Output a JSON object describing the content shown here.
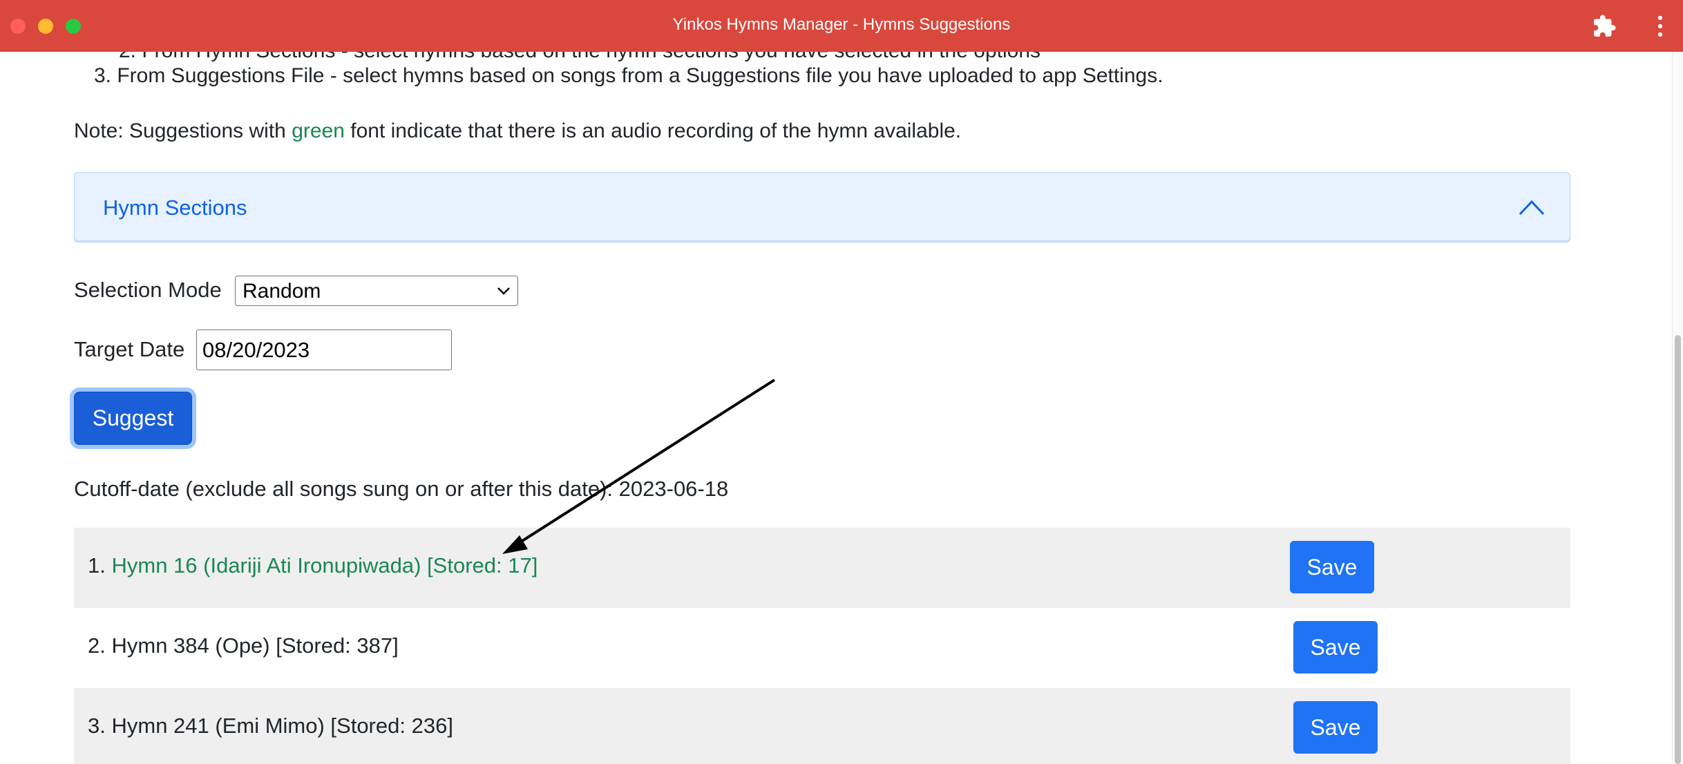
{
  "window": {
    "title": "Yinkos Hymns Manager - Hymns Suggestions"
  },
  "instructions": {
    "partial_line": "2. From Hymn Sections - select hymns based on the hymn sections you have selected in the options",
    "item3": "3. From Suggestions File - select hymns based on songs from a Suggestions file you have uploaded to app Settings."
  },
  "note": {
    "prefix": "Note: Suggestions with ",
    "highlight": "green",
    "suffix": " font indicate that there is an audio recording of the hymn available.",
    "highlight_color": "#198754"
  },
  "accordion": {
    "title": "Hymn Sections",
    "expanded": true
  },
  "selection_mode": {
    "label": "Selection Mode",
    "value": "Random"
  },
  "target_date": {
    "label": "Target Date",
    "value": "08/20/2023"
  },
  "suggest_button": {
    "label": "Suggest"
  },
  "cutoff": {
    "text": "Cutoff-date (exclude all songs sung on or after this date): 2023-06-18"
  },
  "results": [
    {
      "number": "1.",
      "text": "Hymn 16 (Idariji Ati Ironupiwada) [Stored: 17]",
      "has_audio": true,
      "save_label": "Save"
    },
    {
      "number": "2.",
      "text": "Hymn 384 (Ope) [Stored: 387]",
      "has_audio": false,
      "save_label": "Save"
    },
    {
      "number": "3.",
      "text": "Hymn 241 (Emi Mimo) [Stored: 236]",
      "has_audio": false,
      "save_label": "Save"
    }
  ],
  "colors": {
    "titlebar": "#d9473d",
    "accent": "#1f73f4",
    "audio_green": "#198754"
  },
  "icons": [
    "puzzle-extension-icon",
    "more-vertical-icon",
    "chevron-up-icon",
    "select-chevron-down-icon",
    "annotation-arrow"
  ]
}
